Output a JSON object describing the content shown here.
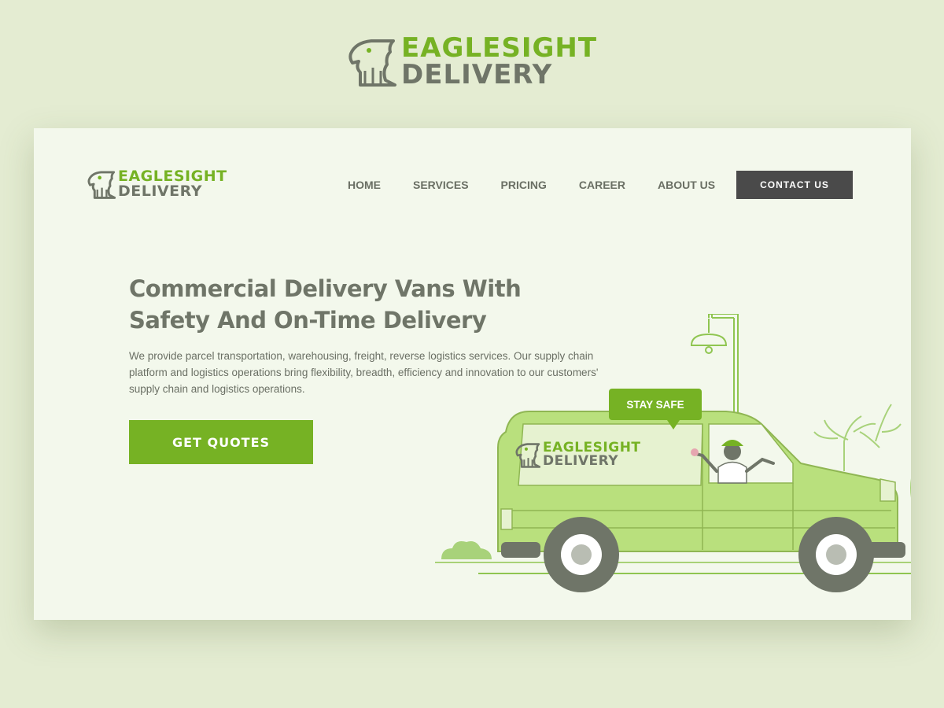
{
  "brand": {
    "line1": "EAGLESIGHT",
    "line2": "DELIVERY",
    "logo_icon": "eagle-icon"
  },
  "nav": {
    "items": [
      "HOME",
      "SERVICES",
      "PRICING",
      "CAREER",
      "ABOUT US"
    ],
    "contact_label": "CONTACT US"
  },
  "hero": {
    "headline": "Commercial Delivery Vans With Safety And On-Time Delivery",
    "description": "We provide parcel transportation, warehousing, freight, reverse logistics services. Our supply chain platform and logistics operations bring flexibility, breadth, efficiency and innovation to our customers' supply chain and logistics operations.",
    "cta_label": "GET QUOTES"
  },
  "illustration": {
    "bubble_text": "STAY SAFE"
  },
  "colors": {
    "accent": "#76b224",
    "text": "#6f7568",
    "dark_button": "#4a4a4a",
    "page_bg": "#e4ecd2",
    "card_bg": "#f3f8ec"
  }
}
